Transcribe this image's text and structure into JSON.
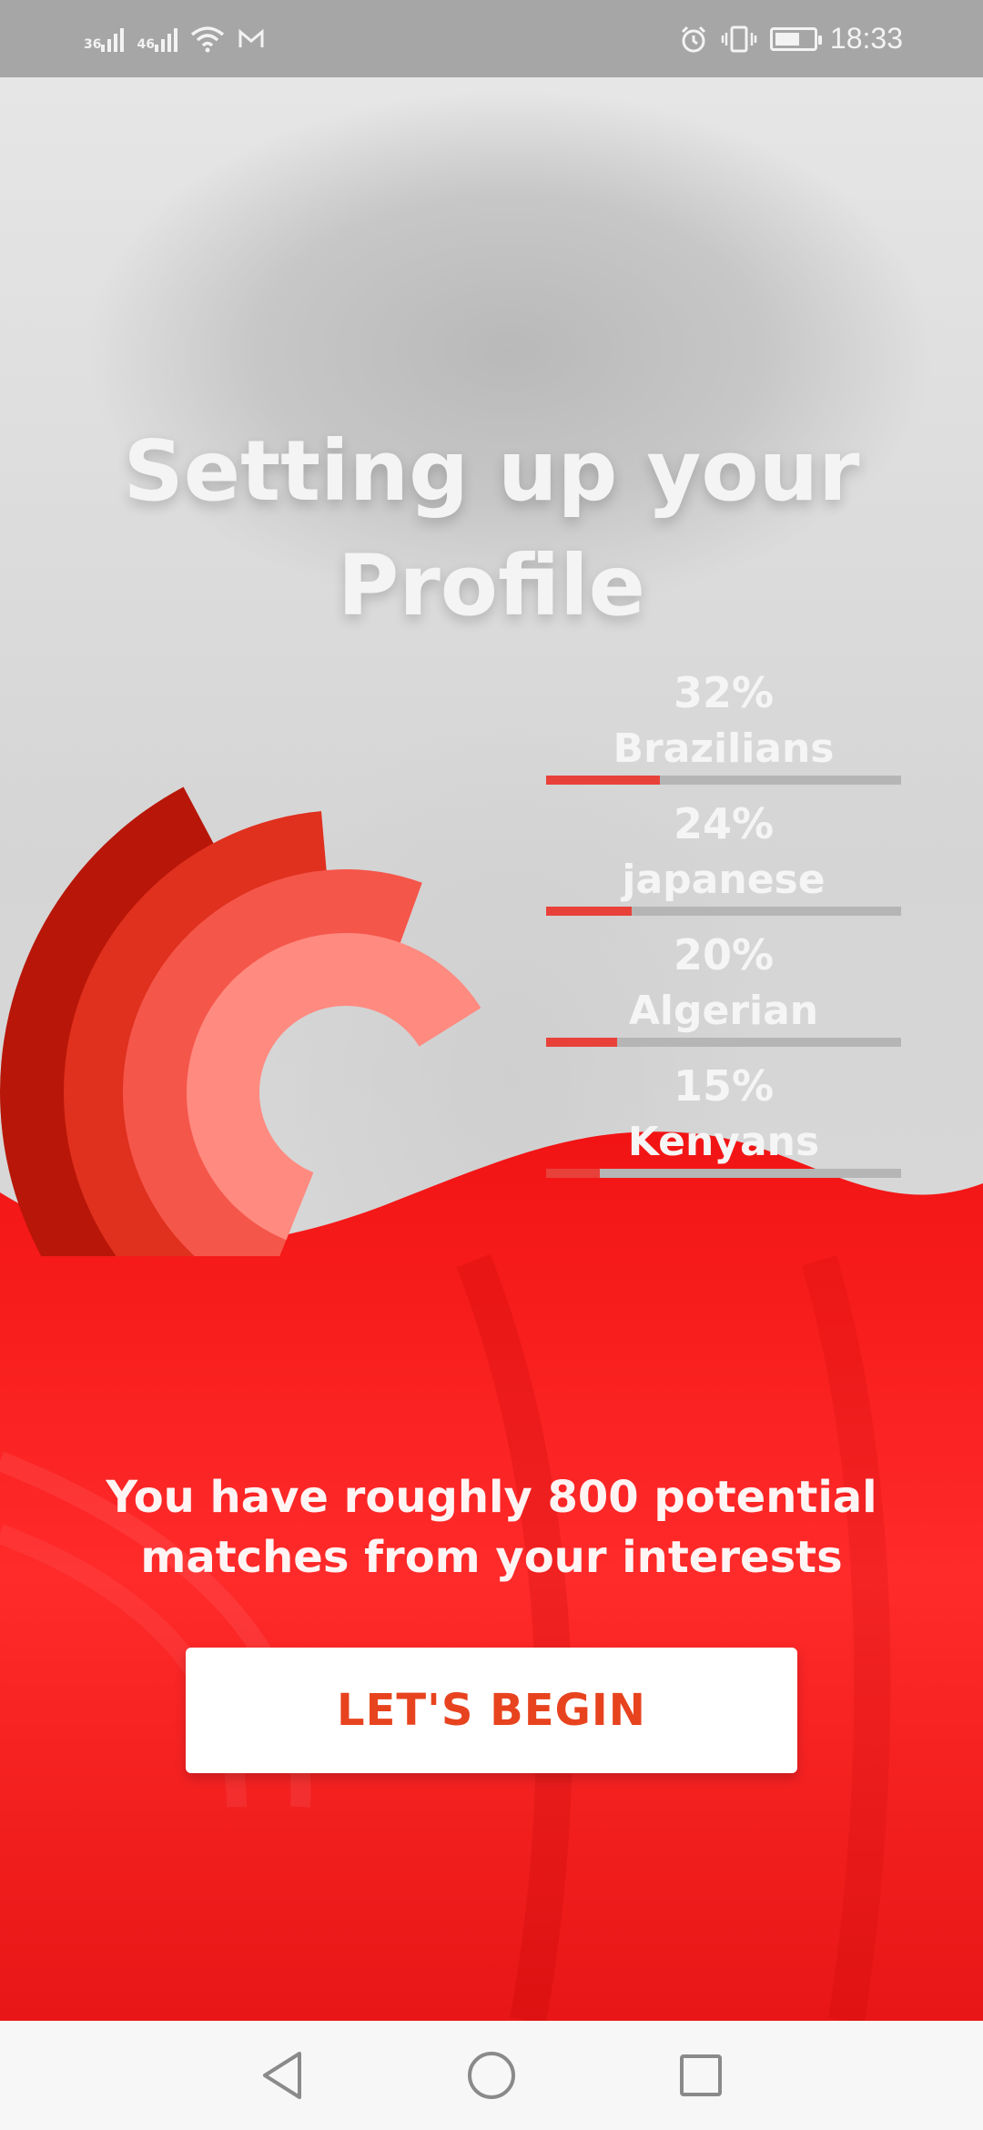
{
  "status_bar": {
    "network_1": "36",
    "network_2": "46",
    "time": "18:33",
    "battery_level": 0.65,
    "icons": [
      "signal-icon",
      "signal-icon",
      "wifi-icon",
      "gmail-icon",
      "alarm-icon",
      "vibrate-icon",
      "battery-icon"
    ]
  },
  "title": {
    "line1": "Setting up your",
    "line2": "Profile"
  },
  "stats": [
    {
      "percent": "32%",
      "label": "Brazilians",
      "value": 0.32
    },
    {
      "percent": "24%",
      "label": "japanese",
      "value": 0.24
    },
    {
      "percent": "20%",
      "label": "Algerian",
      "value": 0.2
    },
    {
      "percent": "15%",
      "label": "Kenyans",
      "value": 0.15
    }
  ],
  "colors": {
    "accent": "#f01e1e",
    "arc_1": "#b81608",
    "arc_2": "#e0301e",
    "arc_3": "#f5564a",
    "arc_4": "#ff8a80",
    "button_text": "#e8431f"
  },
  "subtitle": {
    "line1": "You have roughly 800 potential",
    "line2": "matches from your interests"
  },
  "cta": {
    "label": "LET'S BEGIN"
  },
  "nav": {
    "icons": [
      "back-icon",
      "home-icon",
      "recents-icon"
    ]
  }
}
